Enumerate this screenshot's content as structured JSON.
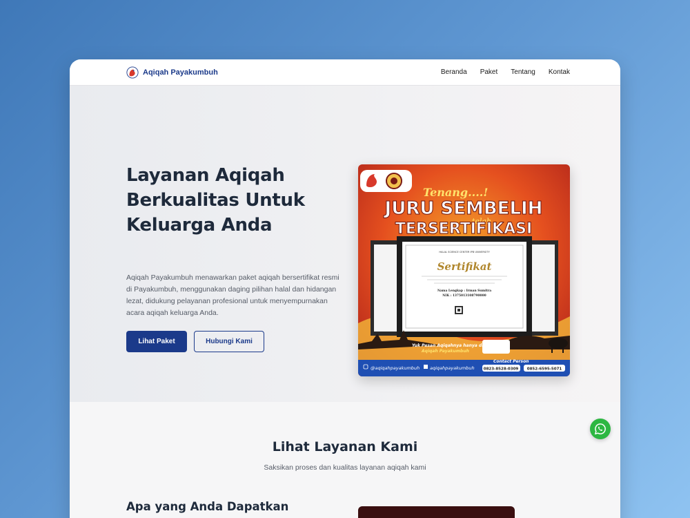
{
  "brand": {
    "name": "Aqiqah Payakumbuh",
    "color": "#1b3a8a"
  },
  "nav": {
    "items": [
      "Beranda",
      "Paket",
      "Tentang",
      "Kontak"
    ]
  },
  "hero": {
    "title": "Layanan Aqiqah Berkualitas Untuk Keluarga Anda",
    "description": "Aqiqah Payakumbuh menawarkan paket aqiqah bersertifikat resmi di Payakumbuh, menggunakan daging pilihan halal dan hidangan lezat, didukung pelayanan profesional untuk menyempurnakan acara aqiqah keluarga Anda.",
    "primary_button": "Lihat Paket",
    "secondary_button": "Hubungi Kami"
  },
  "poster": {
    "tag_line": "Tenang....!",
    "headline_1": "JURU SEMBELIH",
    "connector": "telah",
    "headline_2": "TERSERTIFIKASI",
    "certificate_org": "HALAL SCIENCE CENTER IPB UNIVERSITY",
    "certificate_title": "Sertifikat",
    "certificate_name": "Nama Lengkap : Irman Sumitra",
    "certificate_nik": "NIK : 1375013108790000",
    "slogan_1": "Yuk Pesan Aqiqahnya hanya di",
    "slogan_2": "Aqiqah Payakumbuh",
    "contact_label": "Contact Person",
    "instagram": "@aqiqahpayakumbuh",
    "facebook": "aqiqahpayakumbuh",
    "phone_1": "0823-8528-0309",
    "phone_2": "0852-6595-5071"
  },
  "services": {
    "title": "Lihat Layanan Kami",
    "subtitle": "Saksikan proses dan kualitas layanan aqiqah kami",
    "sub_heading": "Apa yang Anda Dapatkan"
  },
  "colors": {
    "accent": "#1b3a8a",
    "whatsapp": "#2db742",
    "text_dark": "#1e2a3b"
  }
}
